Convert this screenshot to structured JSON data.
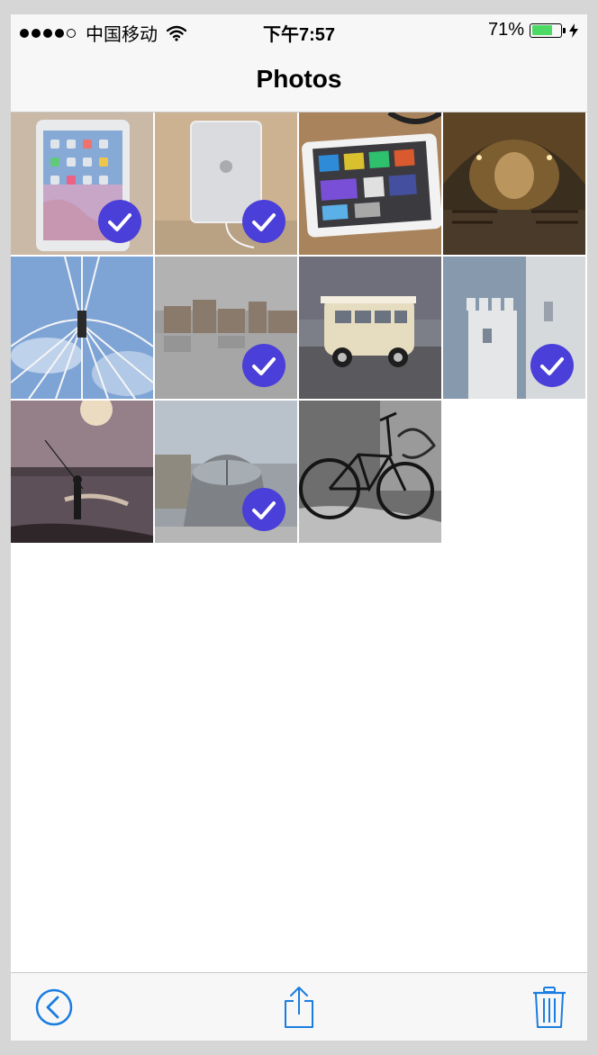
{
  "status_bar": {
    "signal_dots": 4,
    "signal_total": 5,
    "carrier": "中国移动",
    "wifi_icon": "wifi-icon",
    "time": "下午7:57",
    "battery_percent_label": "71%",
    "battery_level": 0.71,
    "charging_icon": "bolt-icon"
  },
  "nav": {
    "title": "Photos"
  },
  "photos": [
    {
      "subject": "ipad-home-screen",
      "selected": true
    },
    {
      "subject": "ipad-back",
      "selected": true
    },
    {
      "subject": "ipad-app-store",
      "selected": false
    },
    {
      "subject": "vaulted-hall",
      "selected": false
    },
    {
      "subject": "ferris-wheel",
      "selected": false
    },
    {
      "subject": "flooded-town",
      "selected": true
    },
    {
      "subject": "vw-van",
      "selected": false
    },
    {
      "subject": "white-tower",
      "selected": true
    },
    {
      "subject": "fisherman-sunset",
      "selected": false
    },
    {
      "subject": "glass-dome",
      "selected": true
    },
    {
      "subject": "bicycle-graffiti",
      "selected": false
    }
  ],
  "toolbar": {
    "back_icon": "back-circle-icon",
    "share_icon": "share-icon",
    "trash_icon": "trash-icon"
  },
  "colors": {
    "accent": "#1a7de0",
    "check": "#4a3fd8",
    "battery": "#4cd964"
  }
}
